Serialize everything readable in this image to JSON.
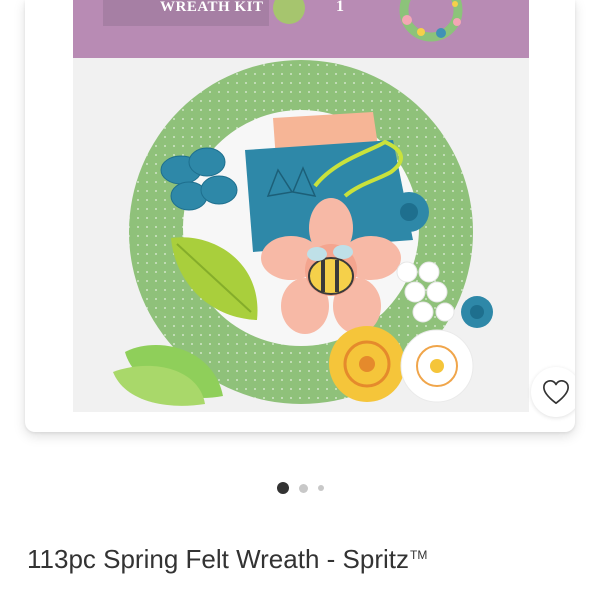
{
  "product": {
    "package_label": "WREATH KIT",
    "package_count": "1",
    "package_kit_text": "1 KIT",
    "title": "113pc Spring Felt Wreath - Spritz",
    "trademark": "TM"
  },
  "carousel": {
    "dot_count": 3,
    "active_index": 0
  },
  "icons": {
    "favorite": "heart-outline-icon"
  },
  "colors": {
    "package_purple": "#b88bb4",
    "wreath_green": "#8fc17a",
    "title_text": "#333333"
  }
}
